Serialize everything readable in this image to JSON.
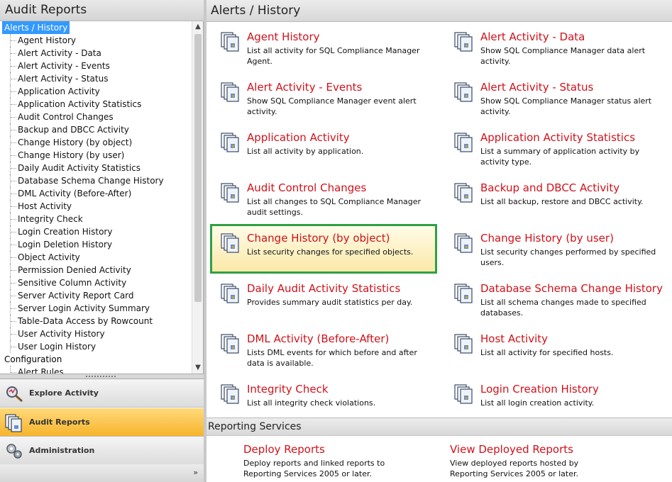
{
  "left_panel": {
    "title": "Audit Reports",
    "tree": {
      "root_selected": "Alerts /  History",
      "children": [
        "Agent History",
        "Alert Activity - Data",
        "Alert Activity - Events",
        "Alert Activity - Status",
        "Application Activity",
        "Application Activity Statistics",
        "Audit Control Changes",
        "Backup and DBCC Activity",
        "Change History (by object)",
        "Change History (by user)",
        "Daily Audit Activity Statistics",
        "Database Schema Change History",
        "DML Activity (Before-After)",
        "Host Activity",
        "Integrity Check",
        "Login Creation History",
        "Login Deletion History",
        "Object Activity",
        "Permission Denied Activity",
        "Sensitive Column Activity",
        "Server Activity Report Card",
        "Server Login Activity Summary",
        "Table-Data Access by Rowcount",
        "User Activity History",
        "User Login History"
      ],
      "root_2": "Configuration",
      "root_2_child": "Alert Rules"
    },
    "nav": [
      {
        "label": "Explore Activity",
        "icon": "explore-activity-icon",
        "active": false
      },
      {
        "label": "Audit Reports",
        "icon": "audit-reports-icon",
        "active": true
      },
      {
        "label": "Administration",
        "icon": "administration-icon",
        "active": false
      }
    ],
    "footer_chevron": "»"
  },
  "main": {
    "title": "Alerts /  History",
    "reports": [
      {
        "title": "Agent History",
        "desc": "List all activity for SQL Compliance Manager Agent."
      },
      {
        "title": "Alert Activity - Data",
        "desc": "Show SQL Compliance Manager data alert activity."
      },
      {
        "title": "Alert Activity - Events",
        "desc": "Show SQL Compliance Manager event alert activity."
      },
      {
        "title": "Alert Activity - Status",
        "desc": "Show SQL Compliance Manager status alert activity."
      },
      {
        "title": "Application Activity",
        "desc": "List all activity by application."
      },
      {
        "title": "Application Activity Statistics",
        "desc": "List a summary of application activity by activity type."
      },
      {
        "title": "Audit Control Changes",
        "desc": "List all changes to SQL Compliance Manager audit settings."
      },
      {
        "title": "Backup and DBCC Activity",
        "desc": "List all backup, restore and DBCC activity."
      },
      {
        "title": "Change History (by object)",
        "desc": "List security changes for specified objects."
      },
      {
        "title": "Change History (by user)",
        "desc": "List security changes performed by specified users."
      },
      {
        "title": "Daily Audit Activity Statistics",
        "desc": "Provides summary audit statistics per day."
      },
      {
        "title": "Database Schema Change History",
        "desc": "List all schema changes made to specified databases."
      },
      {
        "title": "DML Activity (Before-After)",
        "desc": "Lists DML events for which before and after data is available."
      },
      {
        "title": "Host Activity",
        "desc": "List all activity for specified hosts."
      },
      {
        "title": "Integrity Check",
        "desc": "List all integrity check violations."
      },
      {
        "title": "Login Creation History",
        "desc": "List all login creation activity."
      }
    ],
    "reporting_services": {
      "title": "Reporting Services",
      "items": [
        {
          "title": "Deploy Reports",
          "desc": "Deploy reports and linked reports to Reporting Services 2005 or later."
        },
        {
          "title": "View Deployed Reports",
          "desc": "View deployed reports hosted by Reporting Services 2005 or later."
        }
      ]
    }
  },
  "colors": {
    "report_title": "#d1111a",
    "highlight_border": "#2ea043",
    "selected_tree": "#3399ff",
    "active_nav": "#f7b42c"
  }
}
